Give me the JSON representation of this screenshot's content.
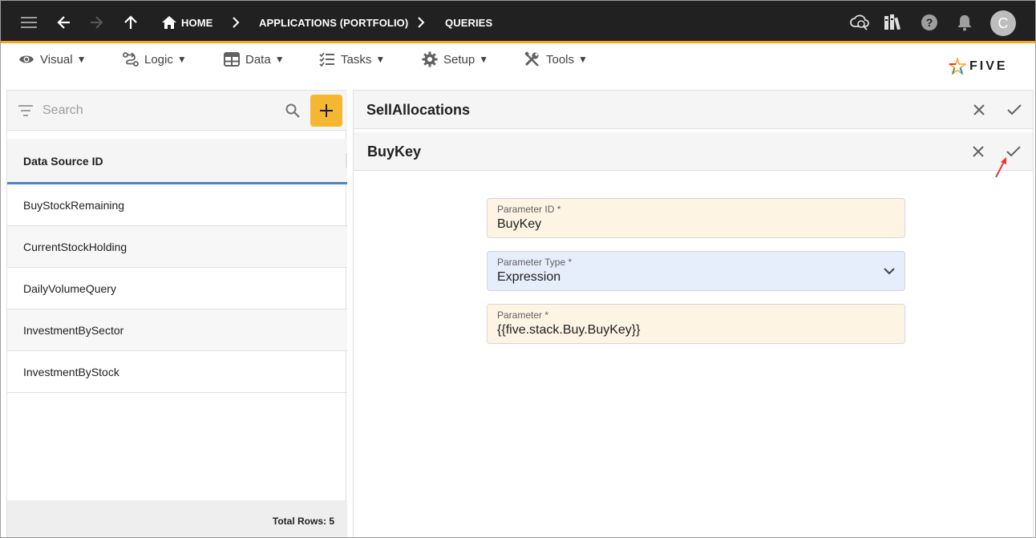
{
  "topbar": {
    "breadcrumbs": [
      "HOME",
      "APPLICATIONS (PORTFOLIO)",
      "QUERIES"
    ],
    "avatar_initial": "C"
  },
  "menu": {
    "items": [
      {
        "label": "Visual",
        "icon": "eye-icon"
      },
      {
        "label": "Logic",
        "icon": "logic-icon"
      },
      {
        "label": "Data",
        "icon": "table-icon"
      },
      {
        "label": "Tasks",
        "icon": "checklist-icon"
      },
      {
        "label": "Setup",
        "icon": "gear-icon"
      },
      {
        "label": "Tools",
        "icon": "tools-icon"
      }
    ],
    "caret": "▼",
    "logo_text": "FIVE"
  },
  "list": {
    "search_placeholder": "Search",
    "column_header": "Data Source ID",
    "rows": [
      "BuyStockRemaining",
      "CurrentStockHolding",
      "DailyVolumeQuery",
      "InvestmentBySector",
      "InvestmentByStock"
    ],
    "total_rows": "Total Rows: 5"
  },
  "forms": {
    "parent_title": "SellAllocations",
    "child_title": "BuyKey",
    "fields": [
      {
        "label": "Parameter ID *",
        "value": "BuyKey"
      },
      {
        "label": "Parameter Type *",
        "value": "Expression"
      },
      {
        "label": "Parameter *",
        "value": "{{five.stack.Buy.BuyKey}}"
      }
    ]
  },
  "colors": {
    "topbar": "#212121",
    "accent": "#f5a623",
    "add_button": "#f5b731",
    "header_underline": "#4a86c8",
    "field_tan": "#fdf4e3",
    "field_blue": "#e6eefb",
    "annotation_arrow": "#e53935"
  }
}
